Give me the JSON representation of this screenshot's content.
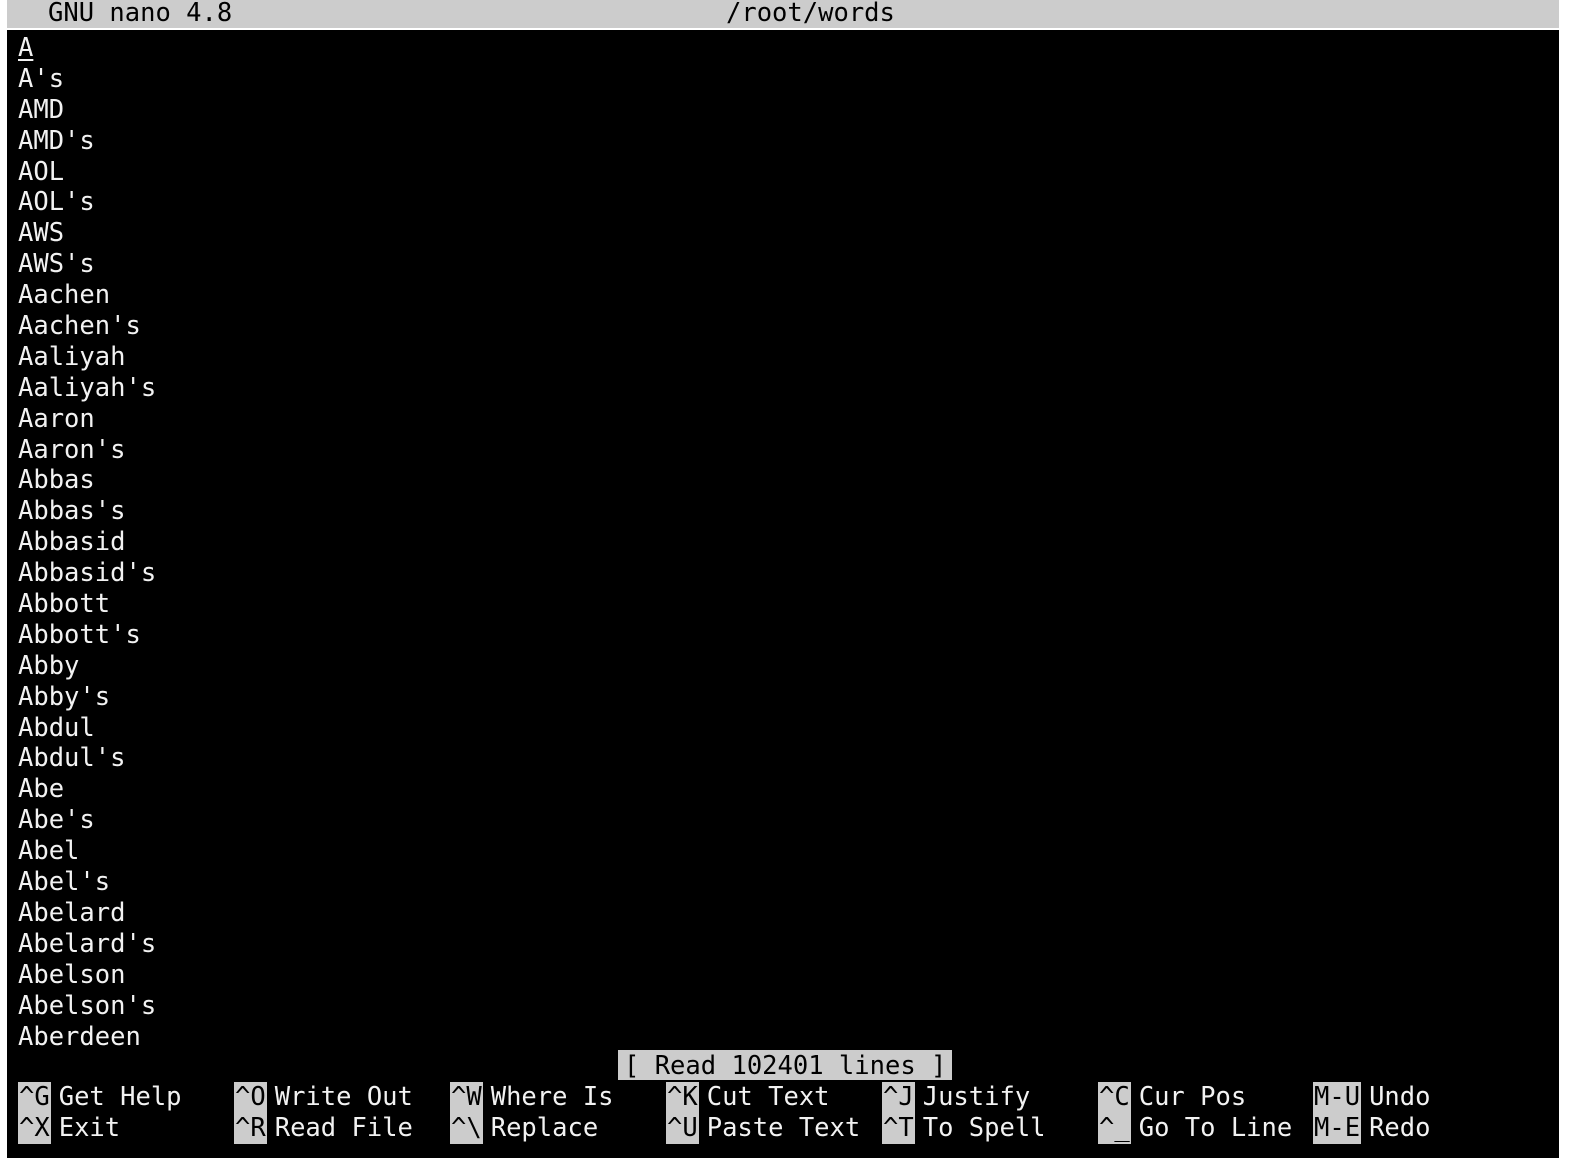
{
  "titlebar": {
    "app": "GNU nano 4.8",
    "file": "/root/words"
  },
  "cursor_char": "A",
  "lines": [
    "A's",
    "AMD",
    "AMD's",
    "AOL",
    "AOL's",
    "AWS",
    "AWS's",
    "Aachen",
    "Aachen's",
    "Aaliyah",
    "Aaliyah's",
    "Aaron",
    "Aaron's",
    "Abbas",
    "Abbas's",
    "Abbasid",
    "Abbasid's",
    "Abbott",
    "Abbott's",
    "Abby",
    "Abby's",
    "Abdul",
    "Abdul's",
    "Abe",
    "Abe's",
    "Abel",
    "Abel's",
    "Abelard",
    "Abelard's",
    "Abelson",
    "Abelson's",
    "Aberdeen"
  ],
  "status": "[ Read 102401 lines ]",
  "shortcuts": {
    "row1": [
      {
        "key": "^G",
        "label": "Get Help"
      },
      {
        "key": "^O",
        "label": "Write Out"
      },
      {
        "key": "^W",
        "label": "Where Is"
      },
      {
        "key": "^K",
        "label": "Cut Text"
      },
      {
        "key": "^J",
        "label": "Justify"
      },
      {
        "key": "^C",
        "label": "Cur Pos"
      },
      {
        "key": "M-U",
        "label": "Undo"
      }
    ],
    "row2": [
      {
        "key": "^X",
        "label": "Exit"
      },
      {
        "key": "^R",
        "label": "Read File"
      },
      {
        "key": "^\\",
        "label": "Replace"
      },
      {
        "key": "^U",
        "label": "Paste Text"
      },
      {
        "key": "^T",
        "label": "To Spell"
      },
      {
        "key": "^_",
        "label": "Go To Line"
      },
      {
        "key": "M-E",
        "label": "Redo"
      }
    ]
  },
  "colors": {
    "background": "#000000",
    "foreground": "#f2f2f2",
    "highlight": "#cccccc"
  }
}
